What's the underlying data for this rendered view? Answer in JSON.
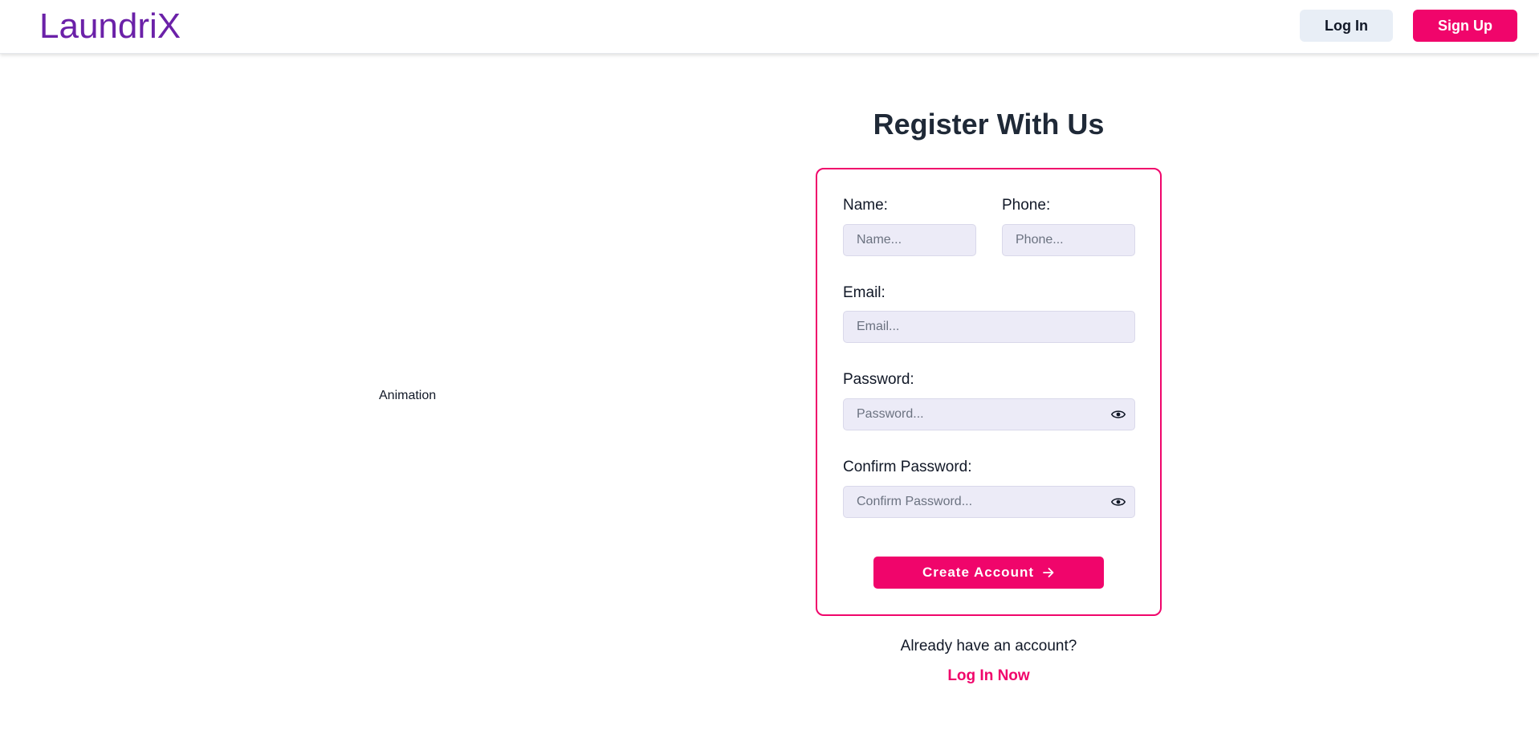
{
  "navbar": {
    "brand": "LaundriX",
    "login_label": "Log In",
    "signup_label": "Sign Up"
  },
  "hero": {
    "animation_label": "Animation"
  },
  "form": {
    "title": "Register With Us",
    "fields": {
      "name": {
        "label": "Name:",
        "placeholder": "Name..."
      },
      "phone": {
        "label": "Phone:",
        "placeholder": "Phone..."
      },
      "email": {
        "label": "Email:",
        "placeholder": "Email..."
      },
      "password": {
        "label": "Password:",
        "placeholder": "Password...",
        "icon": "eye-icon"
      },
      "confirm_password": {
        "label": "Confirm Password:",
        "placeholder": "Confirm Password...",
        "icon": "eye-icon"
      }
    },
    "submit_label": "Create Account",
    "submit_icon": "arrow-right-icon"
  },
  "footer": {
    "already_text": "Already have an account?",
    "login_now_label": "Log In Now"
  },
  "colors": {
    "brand": "#6b21a8",
    "accent": "#f0056b",
    "input_bg": "#ecebf7"
  }
}
